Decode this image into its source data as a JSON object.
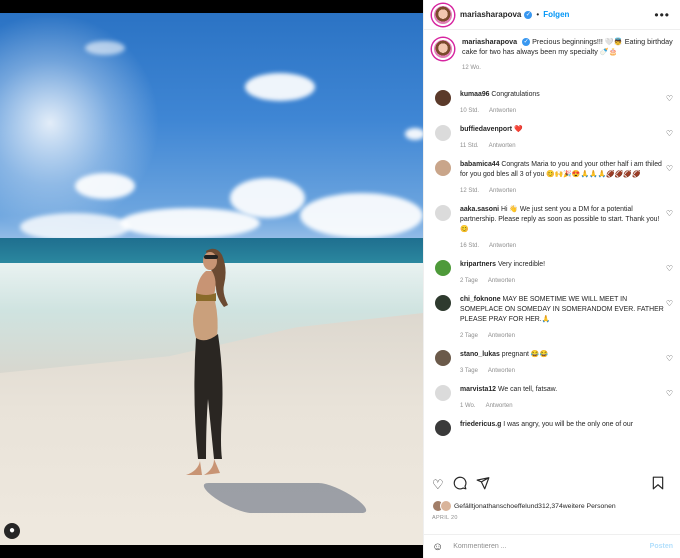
{
  "header": {
    "username": "mariasharapova",
    "follow_label": "Folgen",
    "more_glyph": "•••"
  },
  "caption": {
    "username": "mariasharapova",
    "text": "Precious beginnings!!! 🤍👼 Eating birthday cake for two has always been my specialty 🍼🎂",
    "time": "12 Wo."
  },
  "reply_label": "Antworten",
  "comments": [
    {
      "username": "kumaa96",
      "text": "Congratulations",
      "time": "10 Std.",
      "avatar_color": "#5b3a2a"
    },
    {
      "username": "buffiedavenport",
      "text": "❤️",
      "time": "11 Std.",
      "avatar_color": "#dbdbdb"
    },
    {
      "username": "babamica44",
      "text": "Congrats Maria to you and your other half i am thiled for you god bles all 3 of you 😊🙌🎉😍🙏🙏🙏🏈🏈🏈🏈",
      "time": "12 Std.",
      "avatar_color": "#c9a58a"
    },
    {
      "username": "aaka.sasoni",
      "text": "Hi 👋 We just sent you a DM for a potential partnership. Please reply as soon as possible to start. Thank you! 😊",
      "time": "16 Std.",
      "avatar_color": "#dbdbdb"
    },
    {
      "username": "kripartners",
      "text": "Very incredible!",
      "time": "2 Tage",
      "avatar_color": "#4e9a3a"
    },
    {
      "username": "chi_foknone",
      "text": "MAY BE SOMETIME WE WILL MEET IN SOMEPLACE ON SOMEDAY IN SOMERANDOM EVER. FATHER PLEASE PRAY FOR HER.🙏",
      "time": "2 Tage",
      "avatar_color": "#2e3a2e"
    },
    {
      "username": "stano_lukas",
      "text": "pregnant 😂😂",
      "time": "3 Tage",
      "avatar_color": "#6b5a4a"
    },
    {
      "username": "marvista12",
      "text": "We can tell, fatsaw.",
      "time": "1 Wo.",
      "avatar_color": "#dbdbdb"
    },
    {
      "username": "friedericus.g",
      "text": "I was angry, you will be the only one of our",
      "time": "",
      "avatar_color": "#3a3a3a"
    }
  ],
  "likes": {
    "text_prefix": "Gefällt ",
    "user": "jonathanschoeffel",
    "text_mid": " und ",
    "count": "312,374",
    "text_suffix": " weitere Personen"
  },
  "date": "APRIL 20",
  "add_comment": {
    "emoji_glyph": "☺",
    "placeholder": "Kommentieren ...",
    "post_label": "Posten"
  },
  "icons": {
    "heart": "♡",
    "comment": "◯",
    "share": "➤",
    "bookmark": "☐"
  },
  "colors": {
    "accent": "#0095f6",
    "verified": "#3897f0",
    "meta": "#8e8e8e",
    "post_disabled": "#b2dffc"
  }
}
